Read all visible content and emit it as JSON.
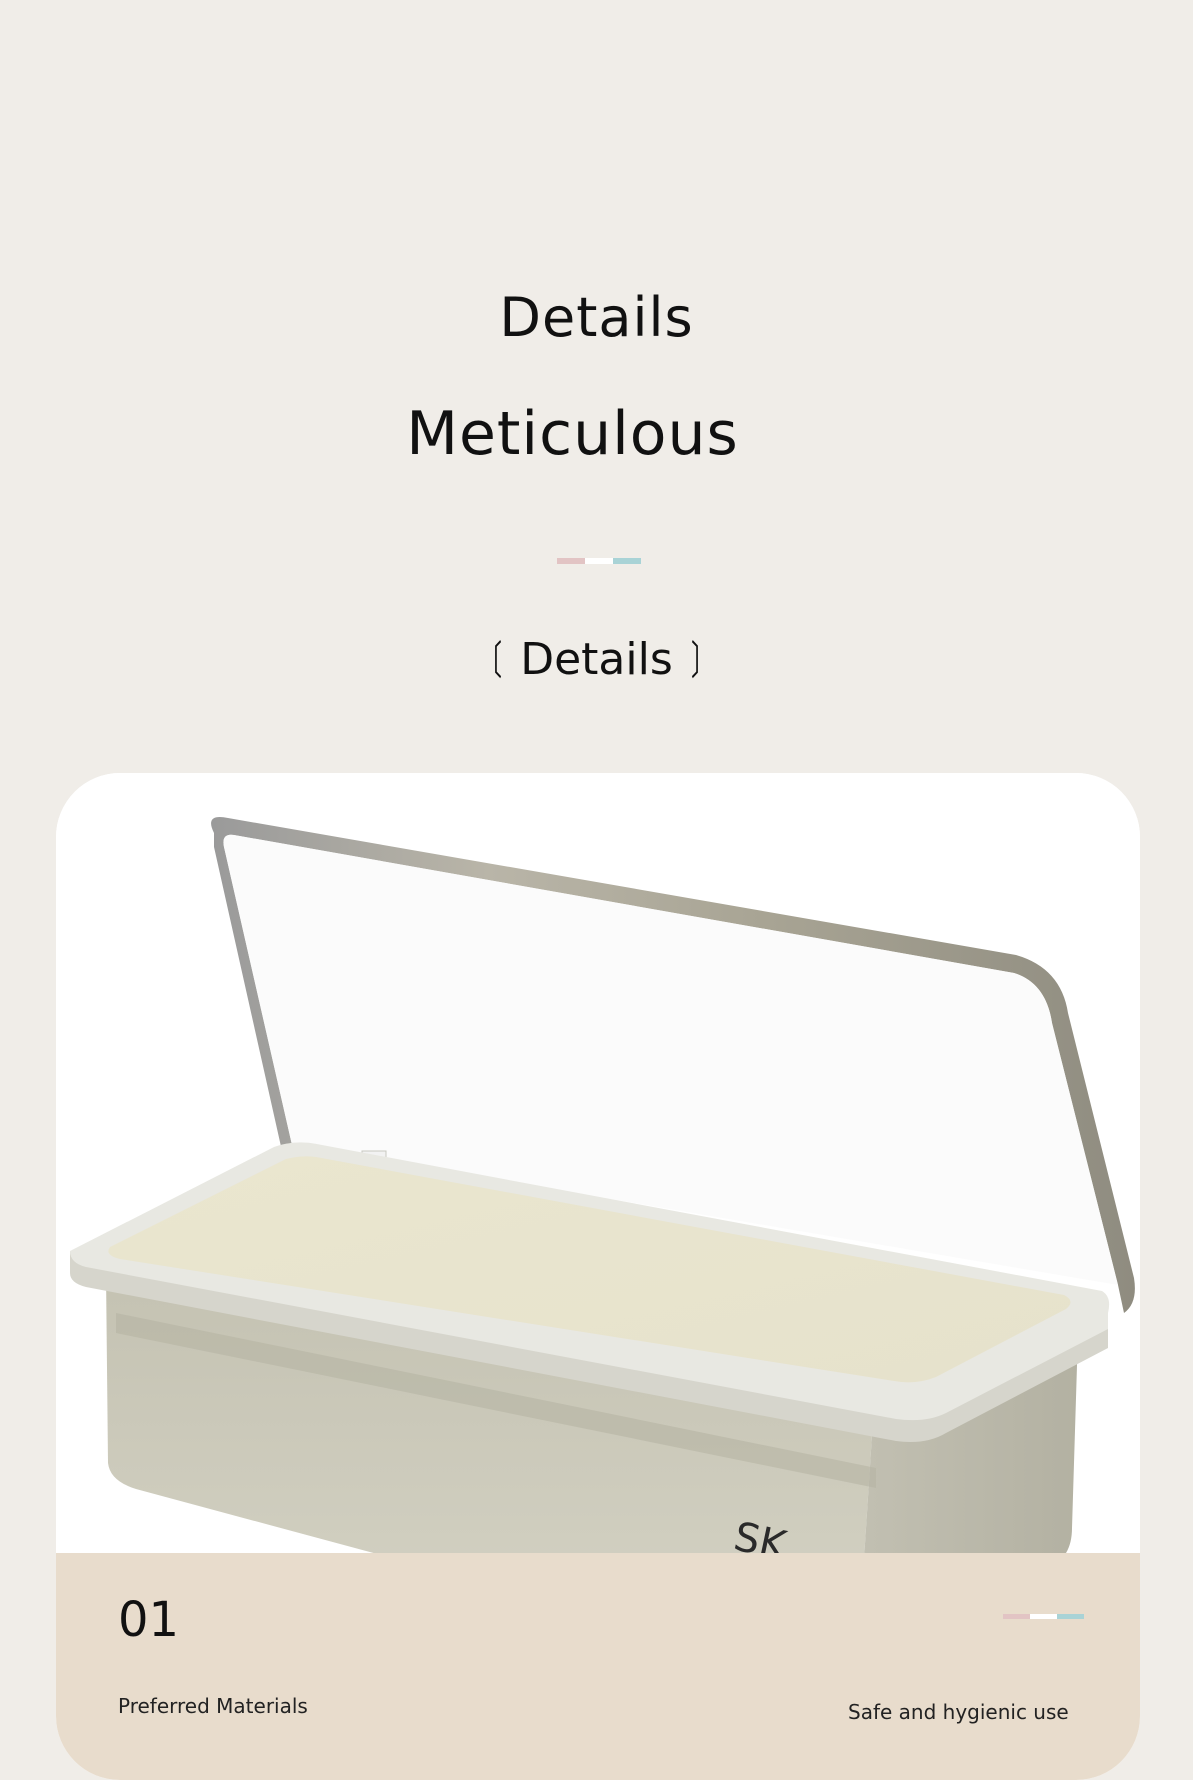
{
  "header": {
    "title_top": "Details",
    "title_main": "Meticulous",
    "divider_colors": [
      "#e2c4c4",
      "#ffffff",
      "#a9d3d6"
    ]
  },
  "section": {
    "bracket_open": "〔",
    "label": "Details",
    "bracket_close": "〕"
  },
  "card": {
    "product_image": "white-rectangular-storage-box-with-clear-hinged-lid",
    "logo_fragment": "SK",
    "number": "01",
    "feature_left": "Preferred Materials",
    "feature_right": "Safe and hygienic use",
    "divider_colors": [
      "#e2c4c4",
      "#ffffff",
      "#a9d3d6"
    ],
    "band_color": "#e8dccc"
  }
}
